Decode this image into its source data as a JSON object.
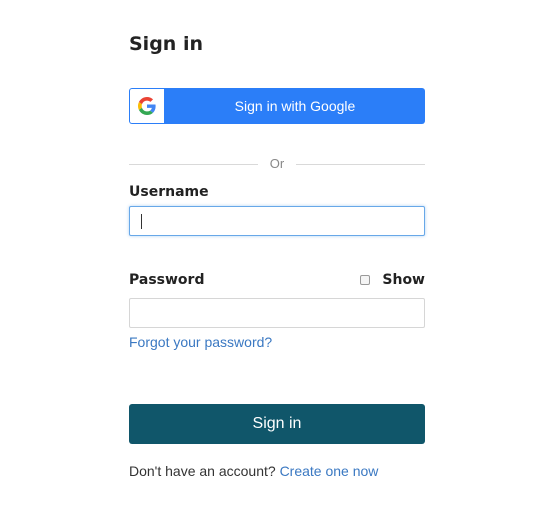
{
  "page": {
    "title": "Sign in"
  },
  "google": {
    "button_label": "Sign in with Google",
    "icon": "google-g-icon",
    "color": "#2b7ef8"
  },
  "divider": {
    "text": "Or"
  },
  "username": {
    "label": "Username",
    "value": "",
    "placeholder": ""
  },
  "password": {
    "label": "Password",
    "value": "",
    "placeholder": "",
    "show_label": "Show",
    "show_checked": false
  },
  "links": {
    "forgot_password": "Forgot your password?"
  },
  "submit": {
    "label": "Sign in",
    "color": "#10566a"
  },
  "signup": {
    "prompt": "Don't have an account?",
    "link": "Create one now"
  }
}
